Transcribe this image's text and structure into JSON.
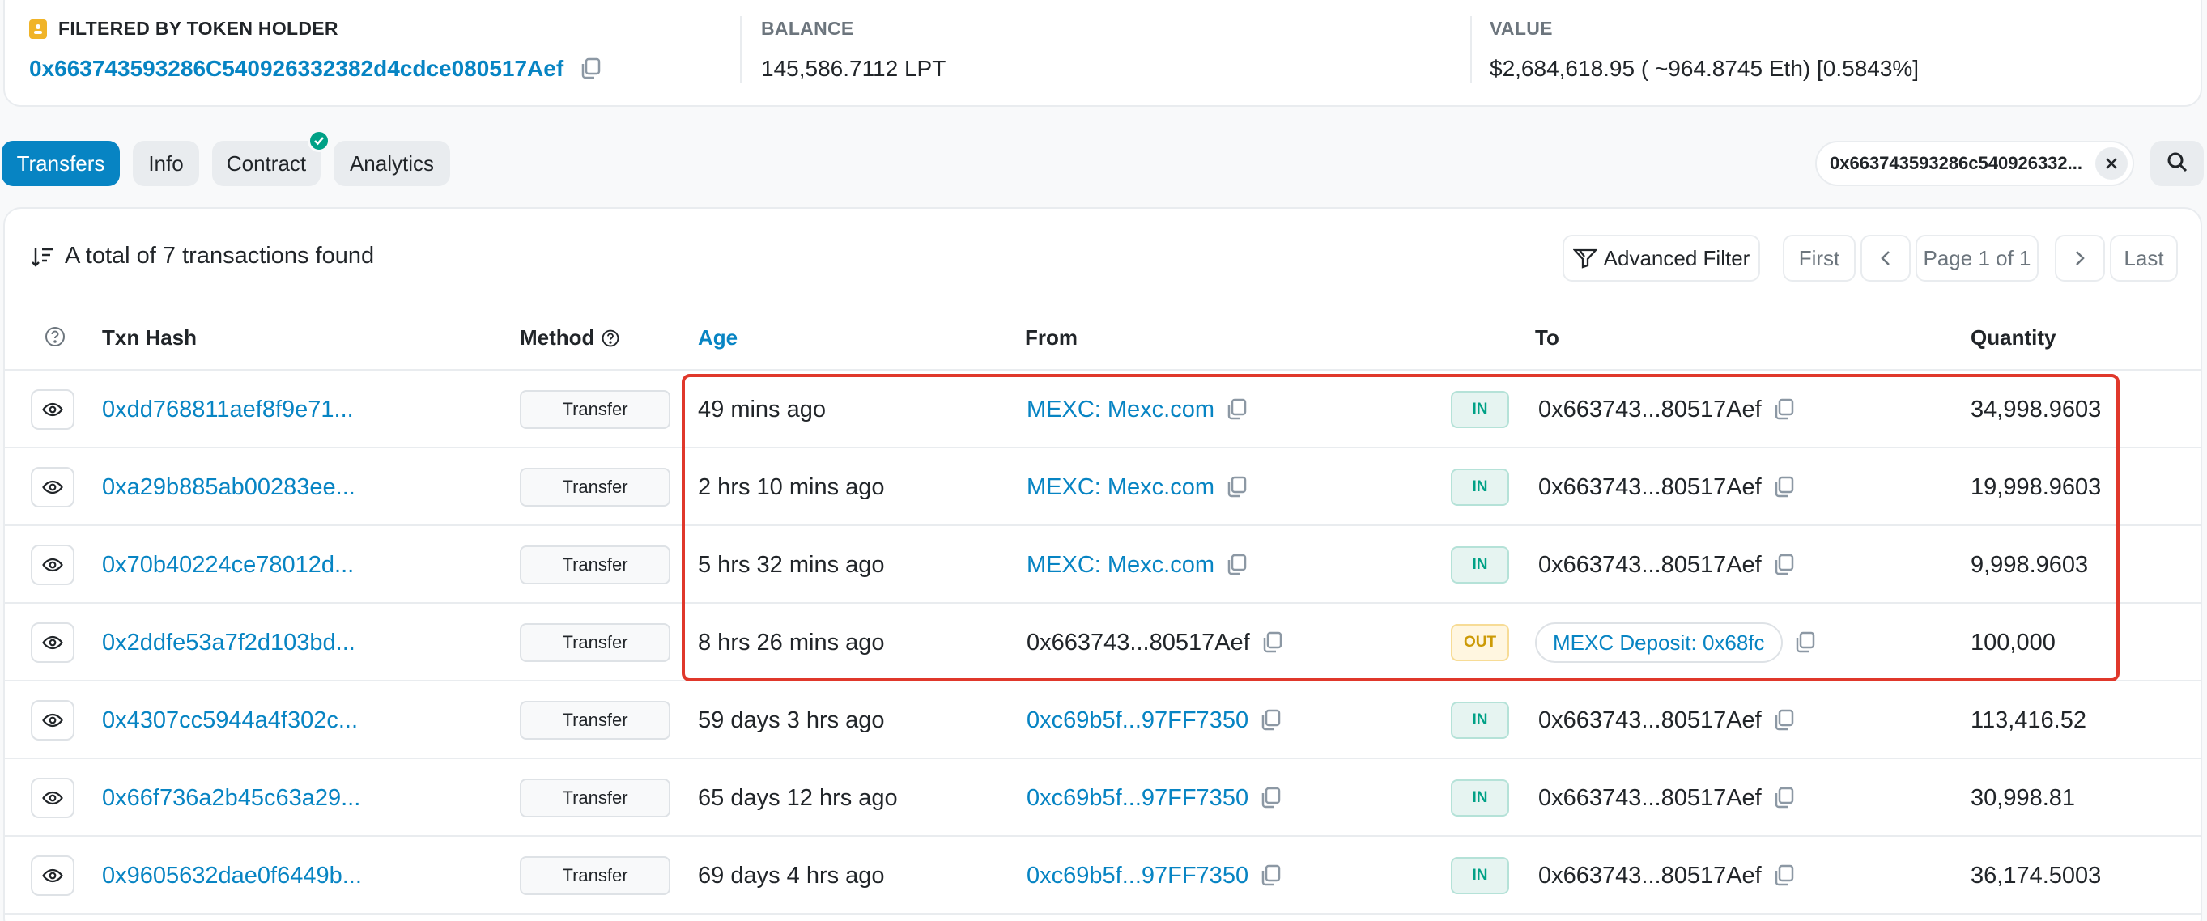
{
  "summary": {
    "holder_label": "FILTERED BY TOKEN HOLDER",
    "holder_address": "0x663743593286C540926332382d4cdce080517Aef",
    "balance_label": "BALANCE",
    "balance_value": "145,586.7112 LPT",
    "value_label": "VALUE",
    "value_value": "$2,684,618.95 ( ~964.8745 Eth) [0.5843%]"
  },
  "tabs": [
    "Transfers",
    "Info",
    "Contract",
    "Analytics"
  ],
  "filter": {
    "value": "0x663743593286c540926332..."
  },
  "toolbar": {
    "total_text": "A total of 7 transactions found",
    "advanced_filter": "Advanced Filter",
    "first": "First",
    "page_info": "Page 1 of 1",
    "last": "Last"
  },
  "columns": {
    "txn_hash": "Txn Hash",
    "method": "Method",
    "age": "Age",
    "from": "From",
    "to": "To",
    "quantity": "Quantity"
  },
  "rows": [
    {
      "hash": "0xdd768811aef8f9e71...",
      "method": "Transfer",
      "age": "49 mins ago",
      "from": "MEXC: Mexc.com",
      "direction": "IN",
      "to": "0x663743...80517Aef",
      "quantity": "34,998.9603"
    },
    {
      "hash": "0xa29b885ab00283ee...",
      "method": "Transfer",
      "age": "2 hrs 10 mins ago",
      "from": "MEXC: Mexc.com",
      "direction": "IN",
      "to": "0x663743...80517Aef",
      "quantity": "19,998.9603"
    },
    {
      "hash": "0x70b40224ce78012d...",
      "method": "Transfer",
      "age": "5 hrs 32 mins ago",
      "from": "MEXC: Mexc.com",
      "direction": "IN",
      "to": "0x663743...80517Aef",
      "quantity": "9,998.9603"
    },
    {
      "hash": "0x2ddfe53a7f2d103bd...",
      "method": "Transfer",
      "age": "8 hrs 26 mins ago",
      "from": "0x663743...80517Aef",
      "direction": "OUT",
      "to": "MEXC Deposit: 0x68fc",
      "quantity": "100,000"
    },
    {
      "hash": "0x4307cc5944a4f302c...",
      "method": "Transfer",
      "age": "59 days 3 hrs ago",
      "from": "0xc69b5f...97FF7350",
      "direction": "IN",
      "to": "0x663743...80517Aef",
      "quantity": "113,416.52"
    },
    {
      "hash": "0x66f736a2b45c63a29...",
      "method": "Transfer",
      "age": "65 days 12 hrs ago",
      "from": "0xc69b5f...97FF7350",
      "direction": "IN",
      "to": "0x663743...80517Aef",
      "quantity": "30,998.81"
    },
    {
      "hash": "0x9605632dae0f6449b...",
      "method": "Transfer",
      "age": "69 days 4 hrs ago",
      "from": "0xc69b5f...97FF7350",
      "direction": "IN",
      "to": "0x663743...80517Aef",
      "quantity": "36,174.5003"
    }
  ],
  "colors": {
    "link": "#0784c3",
    "in_badge": "#00a186",
    "out_badge": "#cc9a06",
    "highlight_box": "#e0382b"
  },
  "icons": [
    "holder-icon",
    "copy-icon",
    "check-icon",
    "close-icon",
    "search-icon",
    "sort-icon",
    "filter-icon",
    "chevron-left-icon",
    "chevron-right-icon",
    "help-icon",
    "eye-icon"
  ]
}
